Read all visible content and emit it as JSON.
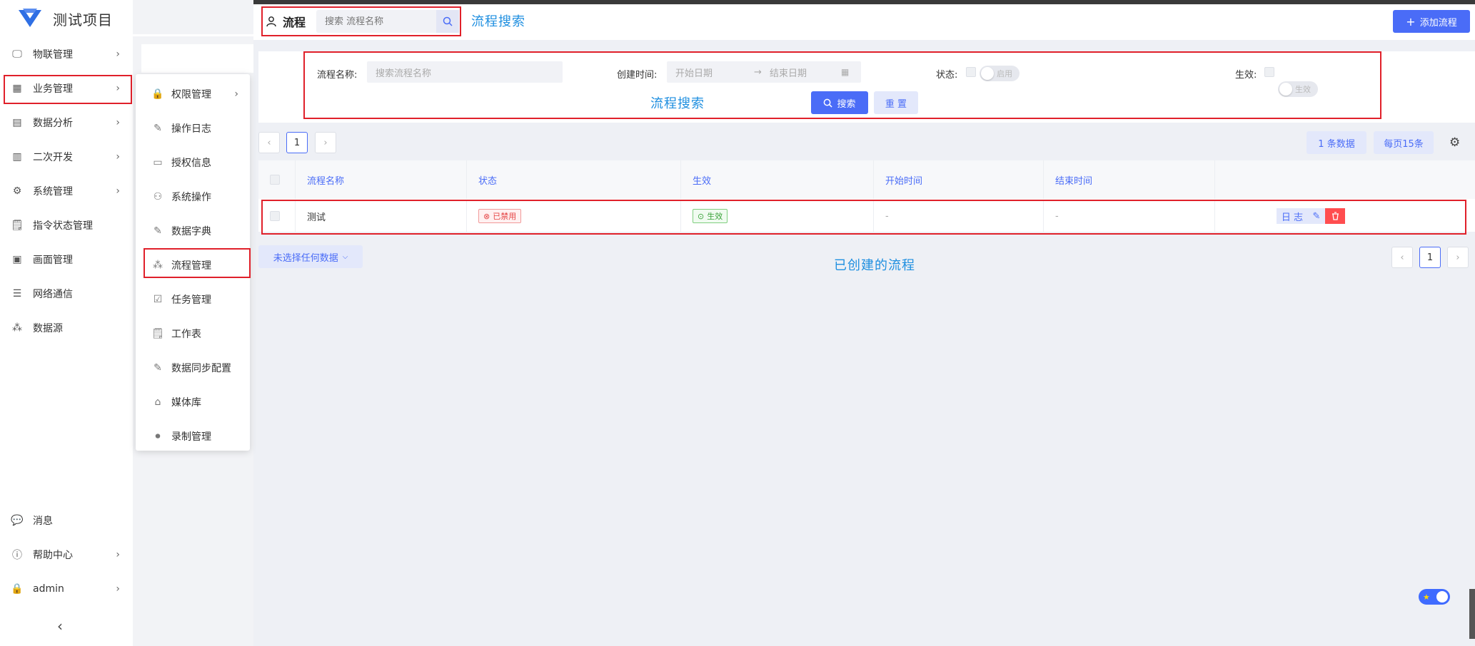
{
  "app": {
    "title": "测试项目"
  },
  "sidebar": {
    "items": [
      {
        "label": "物联管理",
        "icon": "monitor-icon",
        "arrow": true
      },
      {
        "label": "业务管理",
        "icon": "grid-icon",
        "arrow": true
      },
      {
        "label": "数据分析",
        "icon": "chart-doc-icon",
        "arrow": true
      },
      {
        "label": "二次开发",
        "icon": "code-doc-icon",
        "arrow": true
      },
      {
        "label": "系统管理",
        "icon": "gear-icon",
        "arrow": true
      },
      {
        "label": "指令状态管理",
        "icon": "scroll-icon",
        "arrow": false
      },
      {
        "label": "画面管理",
        "icon": "layout-icon",
        "arrow": false
      },
      {
        "label": "网络通信",
        "icon": "list-icon",
        "arrow": false
      },
      {
        "label": "数据源",
        "icon": "cluster-icon",
        "arrow": false
      }
    ],
    "bottom": [
      {
        "label": "消息",
        "icon": "chat-icon",
        "arrow": false
      },
      {
        "label": "帮助中心",
        "icon": "help-icon",
        "arrow": true
      },
      {
        "label": "admin",
        "icon": "lock-icon",
        "arrow": true
      }
    ],
    "collapse": "‹"
  },
  "submenu": {
    "items": [
      {
        "label": "权限管理",
        "icon": "lock-icon",
        "arrow": true
      },
      {
        "label": "操作日志",
        "icon": "edit-doc-icon",
        "arrow": false
      },
      {
        "label": "授权信息",
        "icon": "license-icon",
        "arrow": false
      },
      {
        "label": "系统操作",
        "icon": "circles-icon",
        "arrow": false
      },
      {
        "label": "数据字典",
        "icon": "edit-doc-icon",
        "arrow": false
      },
      {
        "label": "流程管理",
        "icon": "cluster-icon",
        "arrow": false
      },
      {
        "label": "任务管理",
        "icon": "check-doc-icon",
        "arrow": false
      },
      {
        "label": "工作表",
        "icon": "scroll-icon",
        "arrow": false
      },
      {
        "label": "数据同步配置",
        "icon": "edit-doc-icon",
        "arrow": false
      },
      {
        "label": "媒体库",
        "icon": "media-icon",
        "arrow": false
      },
      {
        "label": "录制管理",
        "icon": "record-icon",
        "arrow": false
      }
    ]
  },
  "header": {
    "title": "流程",
    "search_placeholder": "搜索 流程名称",
    "annotation": "流程搜索",
    "add_button": "添加流程"
  },
  "filter": {
    "name_label": "流程名称:",
    "name_placeholder": "搜索流程名称",
    "time_label": "创建时间:",
    "start_placeholder": "开始日期",
    "end_placeholder": "结束日期",
    "arrow": "→",
    "status_label": "状态:",
    "status_toggle": "启用",
    "effect_label": "生效:",
    "effect_toggle": "生效",
    "annotation": "流程搜索",
    "search_button": "搜索",
    "reset_button": "重 置"
  },
  "pagination_top": {
    "prev": "‹",
    "page": "1",
    "next": "›",
    "count": "1 条数据",
    "page_size": "每页15条"
  },
  "table": {
    "columns": [
      "流程名称",
      "状态",
      "生效",
      "开始时间",
      "结束时间"
    ],
    "rows": [
      {
        "name": "测试",
        "status": "已禁用",
        "effect": "生效",
        "start": "-",
        "end": "-",
        "log": "日 志"
      }
    ]
  },
  "footer": {
    "selection": "未选择任何数据",
    "annotation": "已创建的流程",
    "prev": "‹",
    "page": "1",
    "next": "›"
  },
  "colors": {
    "accent": "#4a6cf7",
    "annotation_box": "#e0202a",
    "annotation_text": "#1f8fe0"
  }
}
